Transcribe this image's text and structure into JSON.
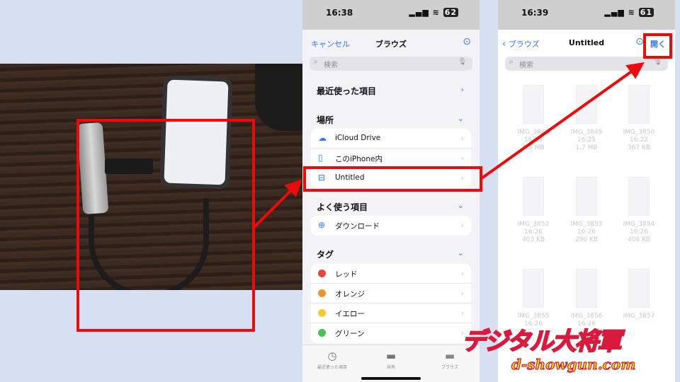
{
  "colors": {
    "accent": "#3478f6",
    "highlight": "#ee0a0a",
    "background": "#d7e0f3"
  },
  "browse": {
    "status_time": "16:38",
    "battery": "62",
    "cancel": "キャンセル",
    "title": "ブラウズ",
    "search_placeholder": "検索",
    "recents": "最近使った項目",
    "locations_header": "場所",
    "locations": [
      {
        "label": "iCloud Drive",
        "icon": "cloud-icon"
      },
      {
        "label": "このiPhone内",
        "icon": "iphone-icon"
      },
      {
        "label": "Untitled",
        "icon": "drive-icon"
      }
    ],
    "favorites_header": "よく使う項目",
    "favorites": [
      {
        "label": "ダウンロード",
        "icon": "download-icon"
      }
    ],
    "tags_header": "タグ",
    "tags": [
      {
        "label": "レッド",
        "color": "#e9463d"
      },
      {
        "label": "オレンジ",
        "color": "#f0952c"
      },
      {
        "label": "イエロー",
        "color": "#f5cb2c"
      },
      {
        "label": "グリーン",
        "color": "#4cbe56"
      }
    ],
    "tabs": [
      {
        "label": "最近使った項目",
        "icon": "clock-icon"
      },
      {
        "label": "共有",
        "icon": "shared-folder-icon"
      },
      {
        "label": "ブラウズ",
        "icon": "folder-icon",
        "active": true
      }
    ]
  },
  "untitled": {
    "status_time": "16:39",
    "battery": "61",
    "back": "ブラウズ",
    "title": "Untitled",
    "open": "開く",
    "search_placeholder": "検索",
    "files": [
      {
        "name": "IMG_3848",
        "time": "16:25",
        "size": "1.5 MB"
      },
      {
        "name": "IMG_3849",
        "time": "16:25",
        "size": "1.7 MB"
      },
      {
        "name": "IMG_3850",
        "time": "16:22",
        "size": "367 KB"
      },
      {
        "name": "IMG_3852",
        "time": "16:26",
        "size": "403 KB"
      },
      {
        "name": "IMG_3853",
        "time": "16:26",
        "size": "290 KB"
      },
      {
        "name": "IMG_3854",
        "time": "16:26",
        "size": "404 KB"
      },
      {
        "name": "IMG_3855",
        "time": "16:26",
        "size": ""
      },
      {
        "name": "IMG_3856",
        "time": "16:26",
        "size": ""
      },
      {
        "name": "IMG_3857",
        "time": "",
        "size": ""
      }
    ]
  },
  "logo": {
    "main": "デジタル大将軍",
    "url": "d-showgun.com"
  }
}
